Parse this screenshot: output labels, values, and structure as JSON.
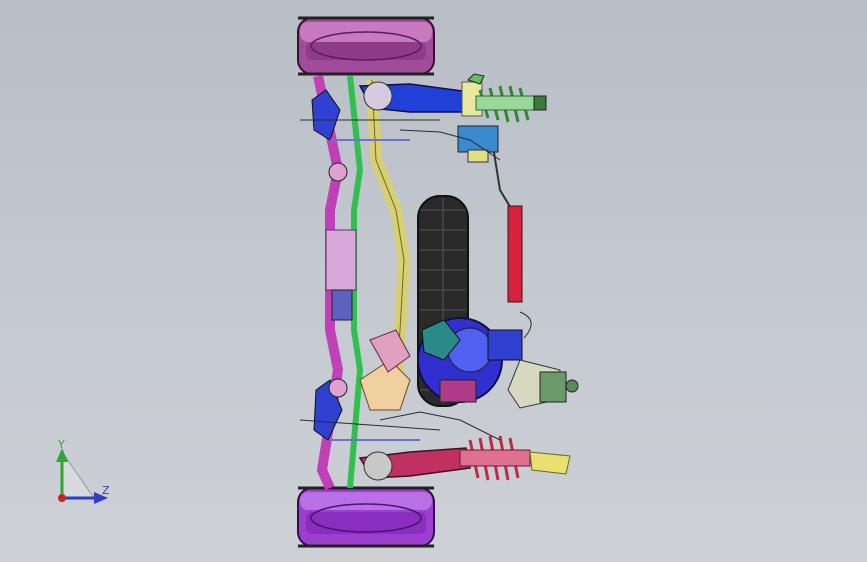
{
  "viewport": {
    "background_top": "#b8bec6",
    "background_bottom": "#cdd1d6"
  },
  "model": {
    "description_colors": {
      "wheel_rim": "#b05aa8",
      "wheel_rim_bottom": "#a23fd0",
      "tire": "#2a2a2a",
      "shock_spring_top": "#4aa84a",
      "shock_spring_bottom": "#c0305a",
      "upper_arm": "#2040d8",
      "lower_arm": "#c03060",
      "tie_rod": "#d02040",
      "steering_box": "#3040e0",
      "frame_magenta": "#d040c8",
      "frame_green": "#30c050",
      "frame_yellow": "#d8d070",
      "hub": "#e0b8d8"
    }
  },
  "triad": {
    "y_label": "Y",
    "z_label": "Z",
    "y_color": "#2fa82f",
    "z_color": "#2a3ec8",
    "origin_color": "#d02020"
  }
}
